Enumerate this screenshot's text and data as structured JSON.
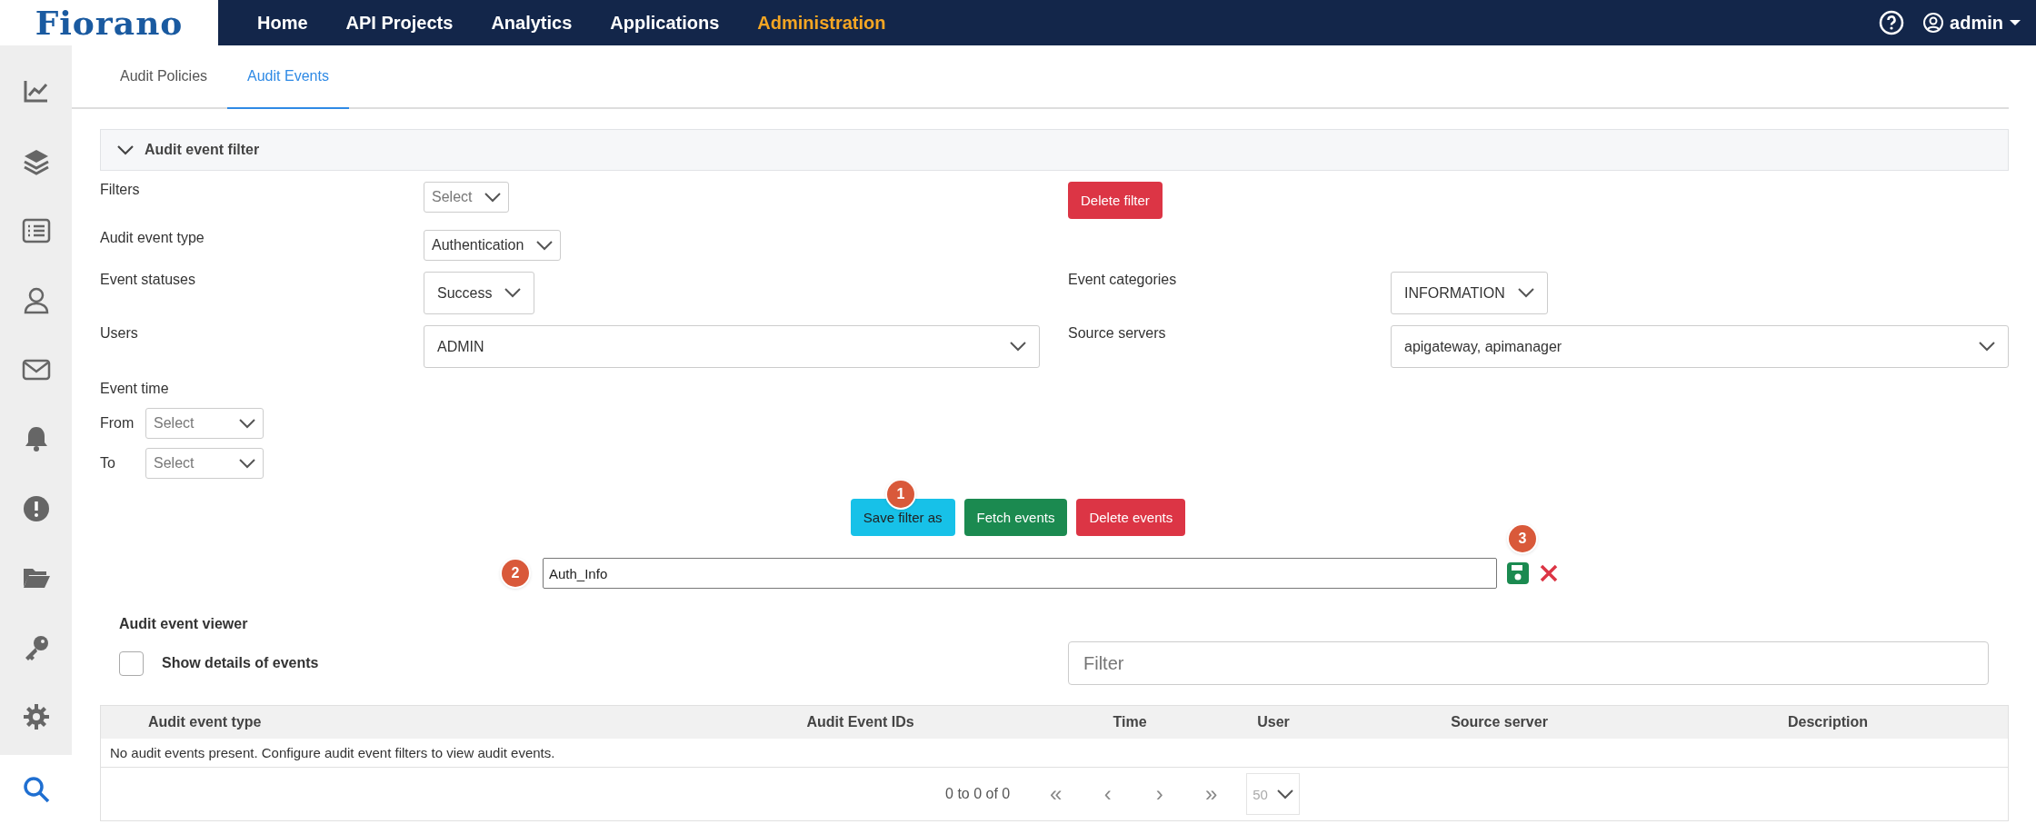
{
  "brand": "Fiorano",
  "nav": [
    {
      "label": "Home",
      "selected": false
    },
    {
      "label": "API Projects",
      "selected": false
    },
    {
      "label": "Analytics",
      "selected": false
    },
    {
      "label": "Applications",
      "selected": false
    },
    {
      "label": "Administration",
      "selected": true
    }
  ],
  "user": "admin",
  "sidebar": {
    "items": [
      {
        "kind": "chart",
        "selected": false
      },
      {
        "kind": "layers",
        "selected": false
      },
      {
        "kind": "list",
        "selected": false
      },
      {
        "kind": "user",
        "selected": false
      },
      {
        "kind": "mail",
        "selected": false
      },
      {
        "kind": "bell",
        "selected": false
      },
      {
        "kind": "alert",
        "selected": false
      },
      {
        "kind": "folder",
        "selected": false
      },
      {
        "kind": "key",
        "selected": false
      },
      {
        "kind": "gear",
        "selected": false
      },
      {
        "kind": "search",
        "selected": true
      }
    ]
  },
  "tabs": [
    {
      "label": "Audit Policies",
      "selected": false
    },
    {
      "label": "Audit Events",
      "selected": true
    }
  ],
  "filter_panel": {
    "title": "Audit event filter",
    "expanded": true,
    "filters": {
      "label": "Filters",
      "placeholder": "Select"
    },
    "delete_filter": "Delete filter",
    "audit_event_type": {
      "label": "Audit event type",
      "value": "Authentication"
    },
    "event_statuses": {
      "label": "Event statuses",
      "value": "Success"
    },
    "event_categories": {
      "label": "Event categories",
      "value": "INFORMATION"
    },
    "users": {
      "label": "Users",
      "value": "ADMIN"
    },
    "source_servers": {
      "label": "Source servers",
      "value": "apigateway, apimanager"
    },
    "event_time": {
      "label": "Event time",
      "from_label": "From",
      "from_placeholder": "Select",
      "to_label": "To",
      "to_placeholder": "Select"
    }
  },
  "actions": [
    {
      "label": "Save filter as",
      "kind": "info",
      "badge": "1"
    },
    {
      "label": "Fetch events",
      "kind": "success"
    },
    {
      "label": "Delete events",
      "kind": "danger"
    }
  ],
  "filter_name": {
    "value": "Auth_Info",
    "badge": "2",
    "save_badge": "3"
  },
  "viewer": {
    "title": "Audit event viewer",
    "show_details": {
      "label": "Show details of events",
      "checked": false
    },
    "filter_placeholder": "Filter"
  },
  "table": {
    "columns": [
      "Audit event type",
      "Audit Event IDs",
      "Time",
      "User",
      "Source server",
      "Description"
    ],
    "empty_message": "No audit events present. Configure audit event filters to view audit events.",
    "pagination": {
      "range": "0 to 0 of 0",
      "first": "«",
      "prev": "‹",
      "next": "›",
      "last": "»",
      "page_size": "50"
    }
  }
}
